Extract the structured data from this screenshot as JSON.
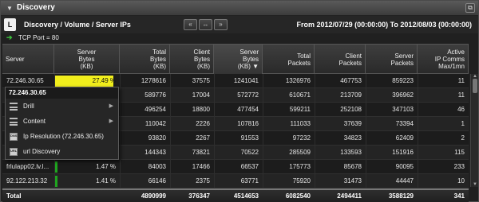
{
  "window": {
    "title": "Discovery",
    "collapse_icon": "triangle-down-icon",
    "restore_icon": "window-restore-icon"
  },
  "toolbar": {
    "logo_text": "L",
    "breadcrumb": "Discovery / Volume / Server IPs",
    "nav_prev": "«",
    "nav_swap": "↔",
    "nav_next": "»",
    "date_range": "From 2012/07/29 (00:00:00) To 2012/08/03 (00:00:00)"
  },
  "filter": {
    "text": "TCP Port = 80"
  },
  "columns": [
    {
      "label": "Server"
    },
    {
      "label": "Server\nBytes\n(KB)"
    },
    {
      "label": "Total\nBytes\n(KB)"
    },
    {
      "label": "Client\nBytes\n(KB)"
    },
    {
      "label": "Server\nBytes\n(KB) ▼"
    },
    {
      "label": "Total\nPackets"
    },
    {
      "label": "Client\nPackets"
    },
    {
      "label": "Server\nPackets"
    },
    {
      "label": "Active\nIP Comms\nMax/1mn"
    }
  ],
  "rows": [
    {
      "server": "72.246.30.65",
      "pct": "27.49 %",
      "pct_value": 27.49,
      "total_bytes": "1278616",
      "client_bytes": "37575",
      "server_bytes": "1241041",
      "total_packets": "1326976",
      "client_packets": "467753",
      "server_packets": "859223",
      "active": "11"
    },
    {
      "server": "",
      "pct": "",
      "pct_value": 0,
      "total_bytes": "589776",
      "client_bytes": "17004",
      "server_bytes": "572772",
      "total_packets": "610671",
      "client_packets": "213709",
      "server_packets": "396962",
      "active": "11"
    },
    {
      "server": "",
      "pct": "",
      "pct_value": 0,
      "total_bytes": "496254",
      "client_bytes": "18800",
      "server_bytes": "477454",
      "total_packets": "599211",
      "client_packets": "252108",
      "server_packets": "347103",
      "active": "46"
    },
    {
      "server": "",
      "pct": "",
      "pct_value": 0,
      "total_bytes": "110042",
      "client_bytes": "2226",
      "server_bytes": "107816",
      "total_packets": "111033",
      "client_packets": "37639",
      "server_packets": "73394",
      "active": "1"
    },
    {
      "server": "",
      "pct": "",
      "pct_value": 0,
      "total_bytes": "93820",
      "client_bytes": "2267",
      "server_bytes": "91553",
      "total_packets": "97232",
      "client_packets": "34823",
      "server_packets": "62409",
      "active": "2"
    },
    {
      "server": "",
      "pct": "",
      "pct_value": 0,
      "total_bytes": "144343",
      "client_bytes": "73821",
      "server_bytes": "70522",
      "total_packets": "285509",
      "client_packets": "133593",
      "server_packets": "151916",
      "active": "115"
    },
    {
      "server": "frlulapp02.lv.l...",
      "pct": "1.47 %",
      "pct_value": 1.47,
      "total_bytes": "84003",
      "client_bytes": "17466",
      "server_bytes": "66537",
      "total_packets": "175773",
      "client_packets": "85678",
      "server_packets": "90095",
      "active": "233"
    },
    {
      "server": "92.122.213.32",
      "pct": "1.41 %",
      "pct_value": 1.41,
      "total_bytes": "66146",
      "client_bytes": "2375",
      "server_bytes": "63771",
      "total_packets": "75920",
      "client_packets": "31473",
      "server_packets": "44447",
      "active": "10"
    }
  ],
  "totals": {
    "label": "Total",
    "server_bytes_pct": "",
    "total_bytes": "4890999",
    "client_bytes": "376347",
    "server_bytes": "4514653",
    "total_packets": "6082540",
    "client_packets": "2494411",
    "server_packets": "3588129",
    "active": "341"
  },
  "context_menu": {
    "header": "72.246.30.65",
    "items": [
      {
        "label": "Drill",
        "icon": "list-icon",
        "submenu": "▶"
      },
      {
        "label": "Content",
        "icon": "list-icon",
        "submenu": "▶"
      },
      {
        "label": "Ip Resolution (72.246.30.65)",
        "icon": "dns-icon",
        "icon_text": "DNS",
        "submenu": ""
      },
      {
        "label": "url Discovery",
        "icon": "url-icon",
        "icon_text": "URL",
        "submenu": ""
      }
    ]
  },
  "colors": {
    "highlight_bar": "#f1ee1c",
    "green_bar": "#1fa51f",
    "accent_arrow": "#3cc13c"
  }
}
